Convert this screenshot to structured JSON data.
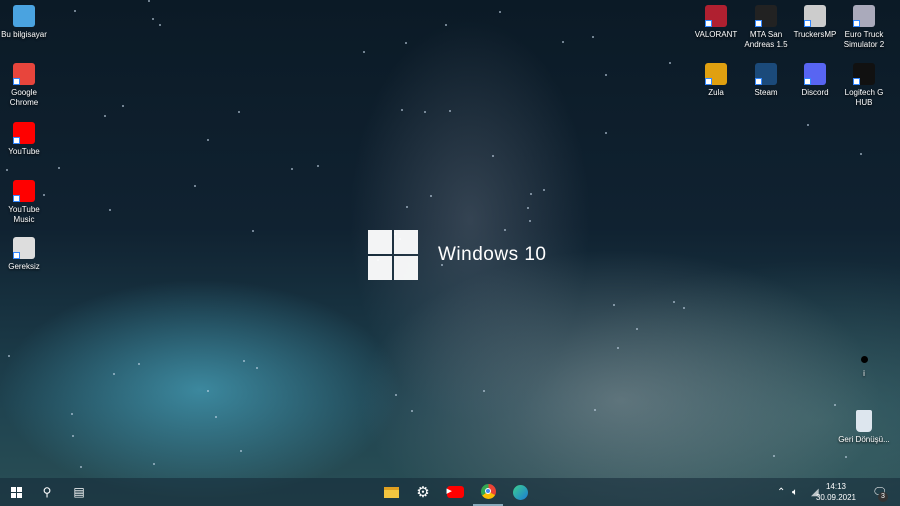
{
  "desktop": {
    "left_icons": [
      {
        "label": "Bu bilgisayar",
        "icon": "computer-icon",
        "color": "#4aa3e0"
      },
      {
        "label": "Google Chrome",
        "icon": "chrome-icon",
        "color": "#e8453c"
      },
      {
        "label": "YouTube",
        "icon": "youtube-icon",
        "color": "#ff0000"
      },
      {
        "label": "YouTube Music",
        "icon": "youtube-music-icon",
        "color": "#ff0000"
      },
      {
        "label": "Gereksiz",
        "icon": "monitor-icon",
        "color": "#ddd"
      }
    ],
    "right_icons": [
      {
        "label": "VALORANT",
        "icon": "valorant-icon",
        "color": "#b02030"
      },
      {
        "label": "MTA San Andreas 1.5",
        "icon": "mta-icon",
        "color": "#222"
      },
      {
        "label": "TruckersMP",
        "icon": "truckersmp-icon",
        "color": "#ccc"
      },
      {
        "label": "Euro Truck Simulator 2",
        "icon": "ets2-icon",
        "color": "#aab"
      },
      {
        "label": "Zula",
        "icon": "zula-icon",
        "color": "#e0a010"
      },
      {
        "label": "Steam",
        "icon": "steam-icon",
        "color": "#1b4a7a"
      },
      {
        "label": "Discord",
        "icon": "discord-icon",
        "color": "#5865f2"
      },
      {
        "label": "Logitech G HUB",
        "icon": "logitech-icon",
        "color": "#111"
      }
    ],
    "misc_icon_label": "i",
    "recycle_bin": "Geri Dönüşü..."
  },
  "wallpaper": {
    "text": "Windows 10"
  },
  "taskbar": {
    "time": "14:13",
    "date": "30.09.2021",
    "notifications": "3"
  }
}
